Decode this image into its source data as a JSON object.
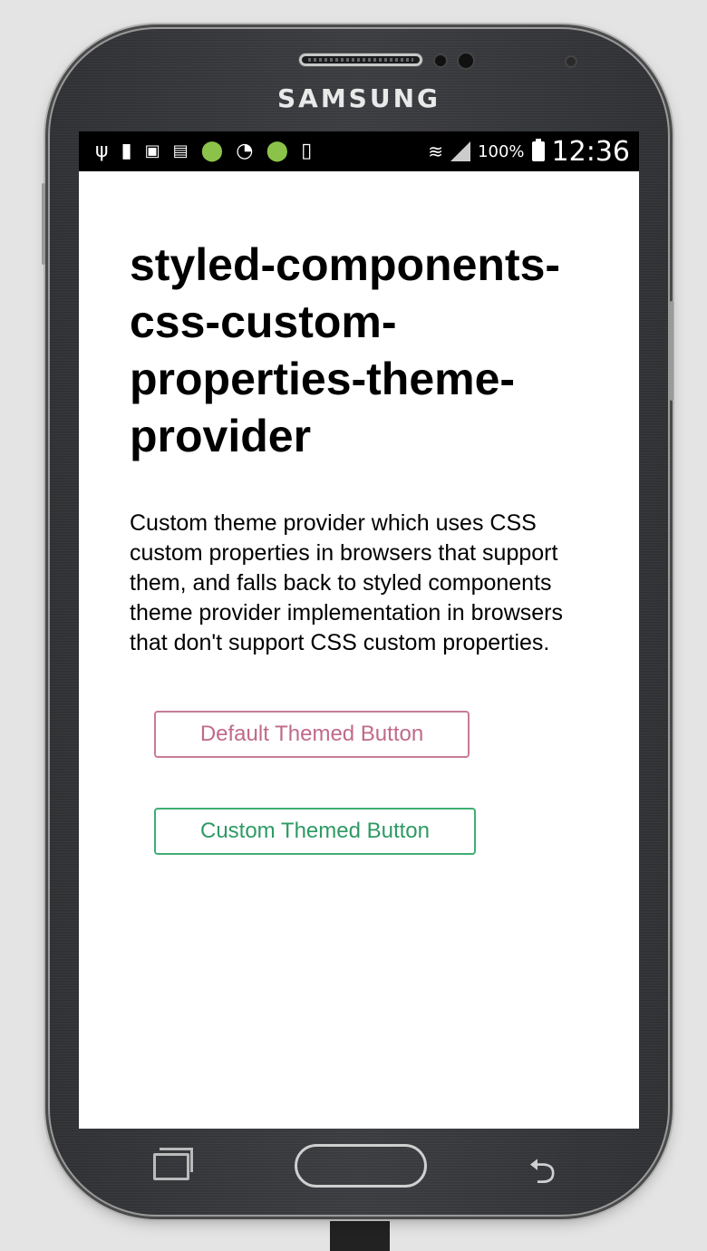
{
  "device": {
    "brand": "SAMSUNG"
  },
  "status_bar": {
    "battery_percent": "100%",
    "time": "12:36"
  },
  "page": {
    "title": "styled-components-css-custom-properties-theme-provider",
    "description": "Custom theme provider which uses CSS custom properties in browsers that support them, and falls back to styled components theme provider implementation in browsers that don't support CSS custom properties."
  },
  "buttons": {
    "default_label": "Default Themed Button",
    "custom_label": "Custom Themed Button"
  },
  "colors": {
    "default_button": "#c97a98",
    "custom_button": "#3fae75",
    "status_bar": "#000000"
  }
}
